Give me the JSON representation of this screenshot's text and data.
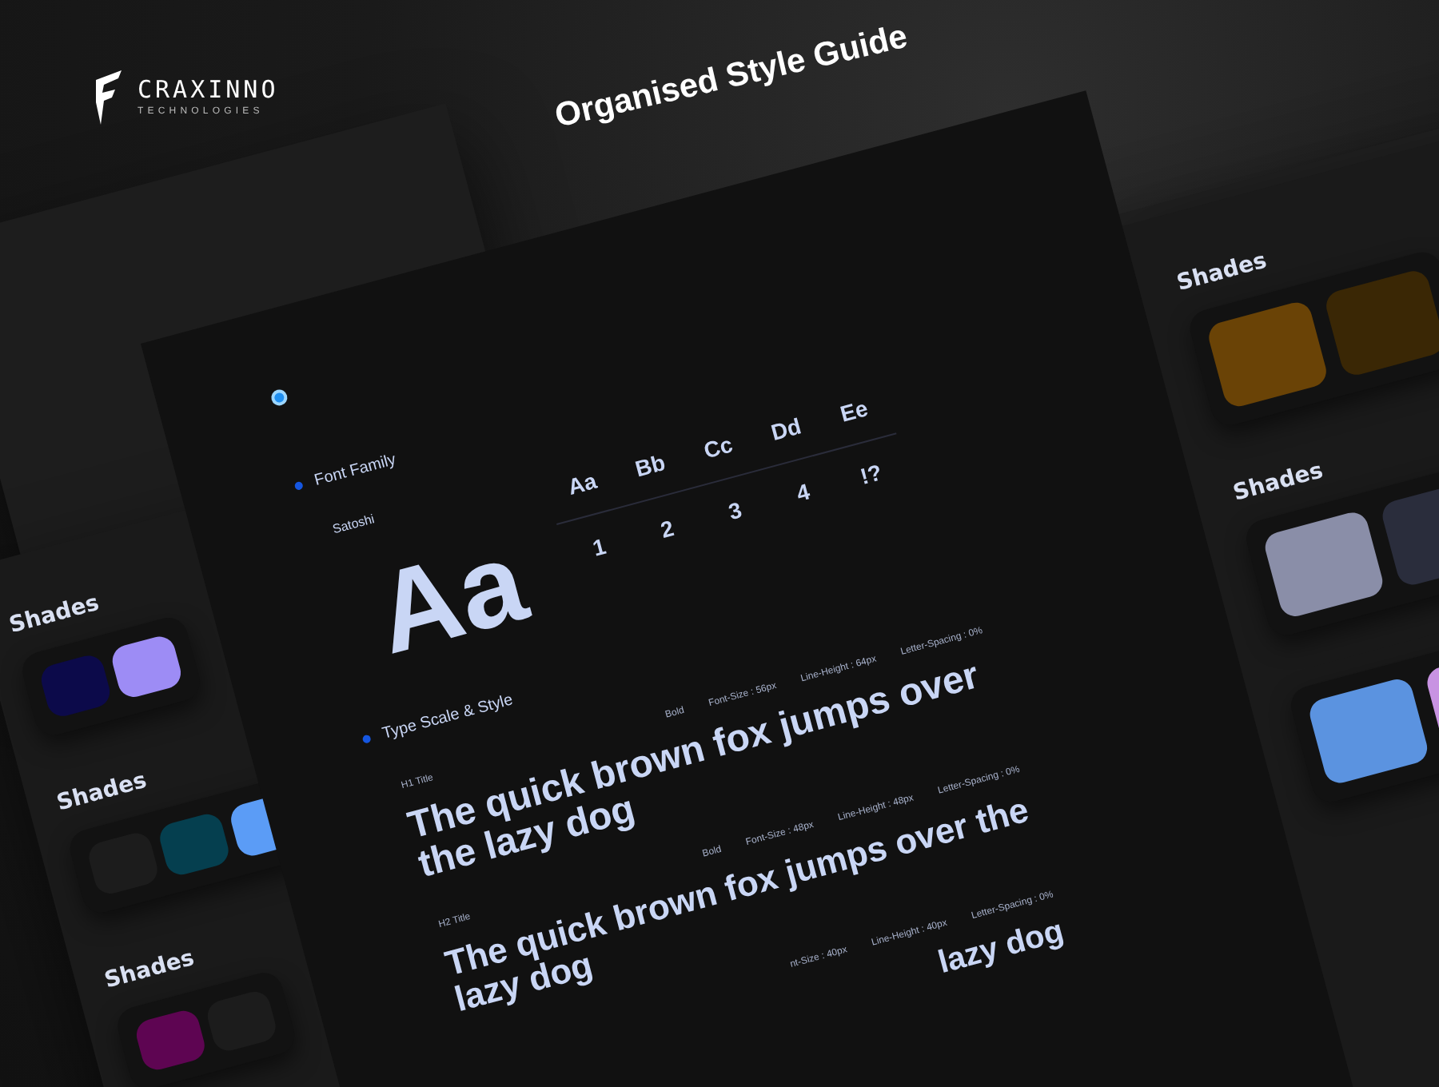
{
  "brand": {
    "name": "CRAXINNO",
    "tagline": "TECHNOLOGIES"
  },
  "title": "Organised Style Guide",
  "left_sheet": {
    "groups": [
      {
        "title": "Shades",
        "swatches": [
          {
            "color": "#0c0a4a"
          },
          {
            "color": "#9d8cf5"
          }
        ]
      },
      {
        "title": "Shades",
        "swatches": [
          {
            "color": "#1c1c1c"
          },
          {
            "color": "#053f4f"
          },
          {
            "color": "#5b9cf6"
          }
        ]
      },
      {
        "title": "Shades",
        "swatches": [
          {
            "color": "#5e0552"
          },
          {
            "color": "#1c1c1c"
          }
        ]
      }
    ]
  },
  "main_sheet": {
    "font_family": {
      "heading": "Font Family",
      "font_name": "Satoshi",
      "specimen": "Aa",
      "glyphs": [
        "Aa",
        "Bb",
        "Cc",
        "Dd",
        "Ee"
      ],
      "numerals": [
        "1",
        "2",
        "3",
        "4",
        "!?"
      ]
    },
    "type_scale": {
      "heading": "Type Scale & Style",
      "styles": [
        {
          "label": "H1 Title",
          "specs": [
            "Bold",
            "Font-Size : 56px",
            "Line-Height : 64px",
            "Letter-Spacing : 0%"
          ],
          "lines": [
            "The quick brown fox jumps over",
            "the lazy dog"
          ]
        },
        {
          "label": "H2 Title",
          "specs": [
            "Bold",
            "Font-Size : 48px",
            "Line-Height : 48px",
            "Letter-Spacing : 0%"
          ],
          "lines": [
            "The quick brown fox jumps over the",
            "lazy dog"
          ]
        },
        {
          "specs": [
            "nt-Size : 40px",
            "Line-Height : 40px",
            "Letter-Spacing : 0%"
          ],
          "lines": [
            "lazy dog"
          ]
        }
      ]
    }
  },
  "right_sheet": {
    "groups": [
      {
        "title": "Shades",
        "swatches": [
          {
            "color": "#6a4306"
          },
          {
            "color": "#3a2705"
          }
        ]
      },
      {
        "title": "Shades",
        "swatches": [
          {
            "color": "#8a8ea8"
          },
          {
            "color": "#2a2d3c"
          }
        ]
      },
      {
        "swatches": [
          {
            "color": "#5b93e0"
          },
          {
            "color": "#c893e2"
          }
        ]
      }
    ]
  }
}
